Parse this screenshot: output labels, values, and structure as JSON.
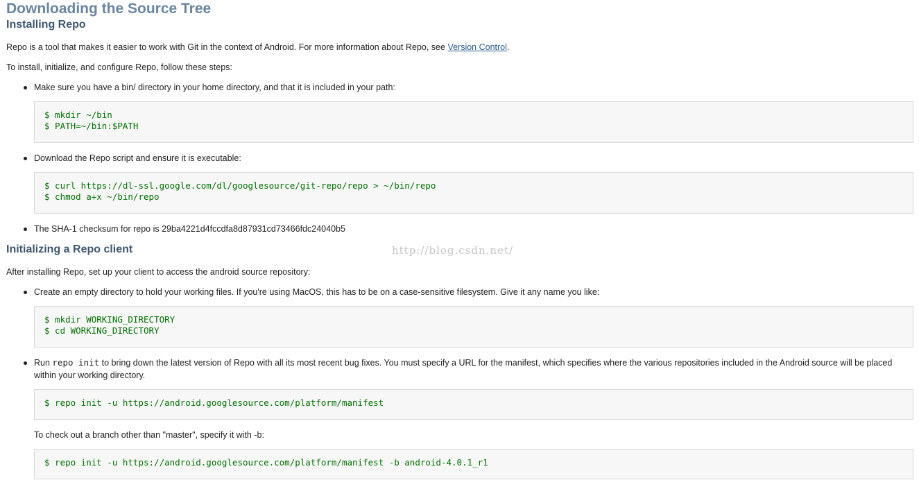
{
  "page_title": "Downloading the Source Tree",
  "section1": {
    "heading": "Installing Repo",
    "intro_text": "Repo is a tool that makes it easier to work with Git in the context of Android. For more information about Repo, see ",
    "intro_link": "Version Control",
    "intro_end": ".",
    "steps_text": "To install, initialize, and configure Repo, follow these steps:",
    "bullet1": "Make sure you have a bin/ directory in your home directory, and that it is included in your path:",
    "code1": "$ mkdir ~/bin\n$ PATH=~/bin:$PATH",
    "bullet2": "Download the Repo script and ensure it is executable:",
    "code2": "$ curl https://dl-ssl.google.com/dl/googlesource/git-repo/repo > ~/bin/repo\n$ chmod a+x ~/bin/repo",
    "bullet3": "The SHA-1 checksum for repo is 29ba4221d4fccdfa8d87931cd73466fdc24040b5"
  },
  "watermark": "http://blog.csdn.net/",
  "section2": {
    "heading": "Initializing a Repo client",
    "intro_text": "After installing Repo, set up your client to access the android source repository:",
    "bullet1": "Create an empty directory to hold your working files. If you're using MacOS, this has to be on a case-sensitive filesystem. Give it any name you like:",
    "code1": "$ mkdir WORKING_DIRECTORY\n$ cd WORKING_DIRECTORY",
    "bullet2_pre": "Run ",
    "bullet2_code": "repo init",
    "bullet2_post": " to bring down the latest version of Repo with all its most recent bug fixes. You must specify a URL for the manifest, which specifies where the various repositories included in the Android source will be placed within your working directory.",
    "code2": "$ repo init -u https://android.googlesource.com/platform/manifest",
    "branch_text": "To check out a branch other than \"master\", specify it with -b:",
    "code3": "$ repo init -u https://android.googlesource.com/platform/manifest -b android-4.0.1_r1"
  }
}
